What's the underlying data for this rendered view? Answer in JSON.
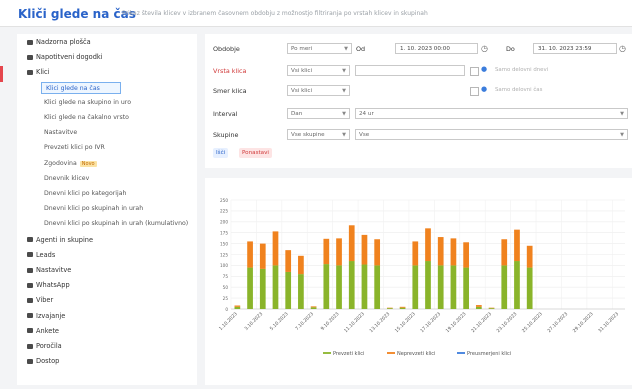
{
  "header": {
    "title": "Kliči glede na čas",
    "subtitle": "Prikaz števila klicev v izbranem časovnem obdobju z možnostjo filtriranja po vrstah klicev in skupinah"
  },
  "sidebar": {
    "items": [
      {
        "label": "Nadzorna plošča",
        "level": 0
      },
      {
        "label": "Napotitveni dogodki",
        "level": 0
      },
      {
        "label": "Klici",
        "level": 0
      },
      {
        "label": "Klici glede na čas",
        "level": 1,
        "active": true
      },
      {
        "label": "Klici glede na skupino in uro",
        "level": 1
      },
      {
        "label": "Klici glede na čakalno vrsto",
        "level": 1
      },
      {
        "label": "Nastavitve",
        "level": 1
      },
      {
        "label": "Prevzeti klici po IVR",
        "level": 1
      },
      {
        "label": "Zgodovina",
        "level": 1,
        "badge": "Novo"
      },
      {
        "label": "Dnevnik klicev",
        "level": 1
      },
      {
        "label": "Dnevni klici po kategorijah",
        "level": 1
      },
      {
        "label": "Dnevni klici po skupinah in urah",
        "level": 1
      },
      {
        "label": "Dnevni klici po skupinah in urah (kumulativno)",
        "level": 1
      },
      {
        "label": "Agenti in skupine",
        "level": 0
      },
      {
        "label": "Leads",
        "level": 0
      },
      {
        "label": "Nastavitve",
        "level": 0
      },
      {
        "label": "WhatsApp",
        "level": 0
      },
      {
        "label": "Viber",
        "level": 0
      },
      {
        "label": "Izvajanje",
        "level": 0
      },
      {
        "label": "Ankete",
        "level": 0
      },
      {
        "label": "Poročila",
        "level": 0
      },
      {
        "label": "Dostop",
        "level": 0
      }
    ]
  },
  "filters": {
    "period_label": "Obdobje",
    "period_value": "Po meri",
    "from_label": "Od",
    "from_value": "1. 10. 2023 00:00",
    "to_label": "Do",
    "to_value": "31. 10. 2023 23:59",
    "type_label": "Vrsta klica",
    "type_value": "Vsi klici",
    "direction_label": "Smer klica",
    "direction_value": "Vsi klici",
    "interval_label": "Interval",
    "interval_value": "Dan",
    "interval_extra": "24 ur",
    "group_label": "Skupine",
    "group_value": "Vse skupine",
    "group_extra": "Vse",
    "chk1_label": "Samo delovni dnevi",
    "chk2_label": "Samo delovni čas",
    "btn_search": "Išči",
    "btn_reset": "Ponastavi"
  },
  "chart_data": {
    "type": "bar",
    "stacked": true,
    "categories": [
      "1.10.2023",
      "2.10.2023",
      "3.10.2023",
      "4.10.2023",
      "5.10.2023",
      "6.10.2023",
      "7.10.2023",
      "8.10.2023",
      "9.10.2023",
      "10.10.2023",
      "11.10.2023",
      "12.10.2023",
      "13.10.2023",
      "14.10.2023",
      "15.10.2023",
      "16.10.2023",
      "17.10.2023",
      "18.10.2023",
      "19.10.2023",
      "20.10.2023",
      "21.10.2023",
      "22.10.2023",
      "23.10.2023",
      "24.10.2023",
      "25.10.2023",
      "26.10.2023",
      "27.10.2023",
      "28.10.2023",
      "29.10.2023",
      "30.10.2023",
      "31.10.2023"
    ],
    "tick_labels": [
      "1.10.2023",
      "3.10.2023",
      "5.10.2023",
      "7.10.2023",
      "9.10.2023",
      "11.10.2023",
      "13.10.2023",
      "15.10.2023",
      "17.10.2023",
      "19.10.2023",
      "21.10.2023",
      "23.10.2023",
      "25.10.2023",
      "27.10.2023",
      "29.10.2023",
      "31.10.2023"
    ],
    "series": [
      {
        "name": "Prevzeti klici",
        "color": "#8ab42a",
        "values": [
          5,
          95,
          92,
          100,
          85,
          80,
          4,
          103,
          100,
          110,
          102,
          100,
          2,
          3,
          100,
          110,
          100,
          100,
          95,
          5,
          2,
          100,
          110,
          95,
          0,
          0,
          0,
          0,
          0,
          0,
          0
        ]
      },
      {
        "name": "Neprevzeti klici",
        "color": "#f0821e",
        "values": [
          3,
          60,
          58,
          78,
          50,
          42,
          2,
          58,
          62,
          82,
          68,
          60,
          1,
          2,
          55,
          75,
          65,
          62,
          58,
          4,
          1,
          60,
          72,
          50,
          0,
          0,
          0,
          0,
          0,
          0,
          0
        ]
      },
      {
        "name": "Preusmerjeni klici",
        "color": "#3c7ddc",
        "values": [
          0,
          0,
          0,
          0,
          0,
          0,
          0,
          0,
          0,
          0,
          0,
          0,
          0,
          0,
          0,
          0,
          0,
          0,
          0,
          0,
          0,
          0,
          0,
          0,
          0,
          0,
          0,
          0,
          0,
          0,
          0
        ]
      }
    ],
    "ylim": [
      0,
      250
    ],
    "yticks": [
      0,
      25,
      50,
      75,
      100,
      125,
      150,
      175,
      200,
      225,
      250
    ],
    "grid": true,
    "legend": "bottom"
  },
  "colors": {
    "accent": "#2a63c9",
    "danger": "#e5464d",
    "green": "#8ab42a",
    "orange": "#f0821e"
  }
}
